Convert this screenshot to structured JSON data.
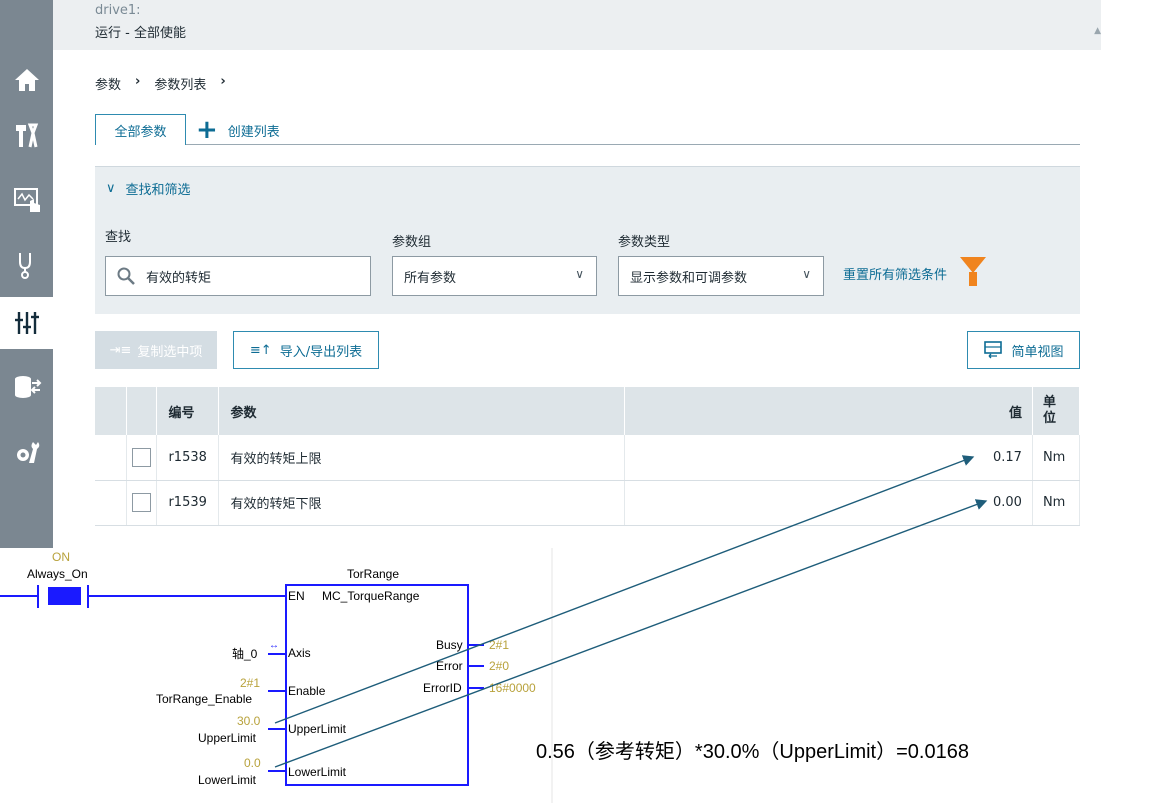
{
  "header": {
    "device": "drive1:",
    "status": "运行 - 全部使能"
  },
  "breadcrumb": {
    "item1": "参数",
    "item2": "参数列表",
    "sep": "›"
  },
  "tabs": {
    "all": "全部参数",
    "create": "创建列表"
  },
  "filter": {
    "title": "查找和筛选",
    "search_label": "查找",
    "search_value": "有效的转矩",
    "group_label": "参数组",
    "group_value": "所有参数",
    "type_label": "参数类型",
    "type_value": "显示参数和可调参数",
    "reset": "重置所有筛选条件"
  },
  "actions": {
    "copy": "复制选中项",
    "import_export": "导入/导出列表",
    "simple_view": "简单视图"
  },
  "table": {
    "headers": {
      "number": "编号",
      "param": "参数",
      "value": "值",
      "unit": "单位"
    },
    "rows": [
      {
        "number": "r1538",
        "param": "有效的转矩上限",
        "value": "0.17",
        "unit": "Nm"
      },
      {
        "number": "r1539",
        "param": "有效的转矩下限",
        "value": "0.00",
        "unit": "Nm"
      }
    ]
  },
  "ladder": {
    "contact_state": "ON",
    "contact_name": "Always_On",
    "block_name": "TorRange",
    "block_type": "MC_TorqueRange",
    "pins": {
      "en": "EN",
      "axis": "Axis",
      "enable": "Enable",
      "upper": "UpperLimit",
      "lower": "LowerLimit",
      "busy": "Busy",
      "error": "Error",
      "errorid": "ErrorID"
    },
    "axis_var": "轴_0",
    "enable_value": "2#1",
    "enable_var": "TorRange_Enable",
    "upper_value": "30.0",
    "upper_var": "UpperLimit",
    "lower_value": "0.0",
    "lower_var": "LowerLimit",
    "busy_value": "2#1",
    "error_value": "2#0",
    "errorid_value": "16#0000"
  },
  "formula": "0.56（参考转矩）*30.0%（UpperLimit）=0.0168",
  "colors": {
    "accent": "#0d6c94",
    "sidebar": "#7b8791",
    "ladder_blue": "#1a1aff",
    "funnel": "#f0841e"
  }
}
